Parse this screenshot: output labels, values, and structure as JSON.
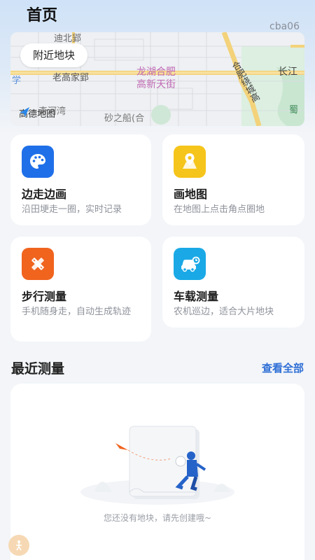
{
  "header": {
    "title": "首页",
    "user_tag": "cba06"
  },
  "map": {
    "nearby_button": "附近地块",
    "provider": "高德地图",
    "labels": {
      "street_north": "迪北郢",
      "xue": "学",
      "laogaojia": "老高家郢",
      "longhu": "龙湖合肥",
      "gaoxin": "高新天街",
      "hefei_road": "合肥绕城高",
      "changjiang": "长江",
      "shu": "蜀",
      "shazhichuan": "砂之船(合",
      "qihe": "奇河湾"
    }
  },
  "cards": [
    {
      "title": "边走边画",
      "desc": "沿田埂走一圈，实时记录",
      "icon": "palette-icon",
      "color": "#1f6fe8"
    },
    {
      "title": "画地图",
      "desc": "在地图上点击角点圈地",
      "icon": "map-pin-icon",
      "color": "#f6c51b"
    },
    {
      "title": "步行测量",
      "desc": "手机随身走，自动生成轨迹",
      "icon": "pencil-ruler-icon",
      "color": "#f0641e"
    },
    {
      "title": "车载测量",
      "desc": "农机巡边，适合大片地块",
      "icon": "car-icon",
      "color": "#1aa9e6"
    }
  ],
  "recent": {
    "title": "最近测量",
    "view_all": "查看全部",
    "empty_text": "您还没有地块，请先创建哦~"
  }
}
